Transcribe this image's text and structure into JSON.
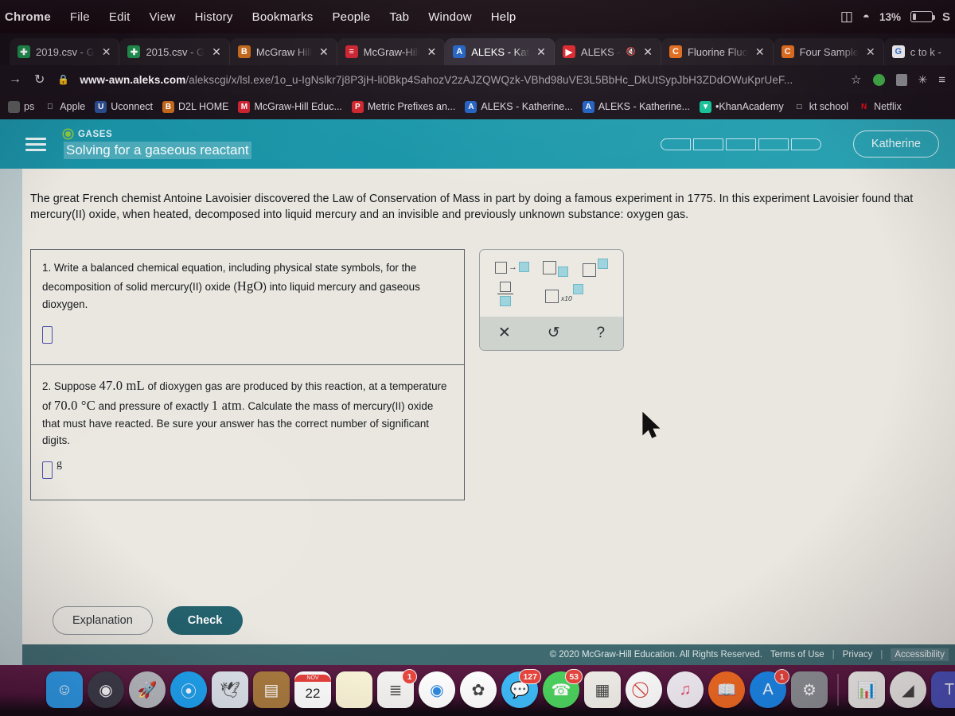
{
  "macos": {
    "menu_items": [
      "Chrome",
      "File",
      "Edit",
      "View",
      "History",
      "Bookmarks",
      "People",
      "Tab",
      "Window",
      "Help"
    ],
    "status": {
      "battery_percent": "13%",
      "trailing_letter": "S",
      "icons": [
        "airplay-icon",
        "wifi-icon",
        "battery-icon"
      ]
    }
  },
  "browser": {
    "tabs": [
      {
        "label": "2019.csv - G",
        "favicon": "sheets-icon",
        "color": "#1d8b4b",
        "glyph": "✚",
        "active": false
      },
      {
        "label": "2015.csv - G",
        "favicon": "sheets-icon",
        "color": "#1d8b4b",
        "glyph": "✚",
        "active": false
      },
      {
        "label": "McGraw Hill",
        "favicon": "bookshelf-icon",
        "color": "#c0651b",
        "glyph": "B",
        "active": false
      },
      {
        "label": "McGraw-Hill",
        "favicon": "mheducation-icon",
        "color": "#c9202e",
        "glyph": "≡",
        "active": false
      },
      {
        "label": "ALEKS - Kat",
        "favicon": "aleks-icon",
        "color": "#1f5fbf",
        "glyph": "A",
        "active": true
      },
      {
        "label": "ALEKS -",
        "favicon": "youtube-icon",
        "color": "#d8232a",
        "glyph": "▶",
        "active": false,
        "muted_icon": "audio-muted-icon"
      },
      {
        "label": "Fluorine Fluo",
        "favicon": "course-hero-icon",
        "color": "#e06a1b",
        "glyph": "C",
        "active": false
      },
      {
        "label": "Four Sample",
        "favicon": "course-hero-icon",
        "color": "#e06a1b",
        "glyph": "C",
        "active": false
      },
      {
        "label": "c to k -",
        "favicon": "google-icon",
        "color": "#ffffff",
        "glyph": "G",
        "active": false
      }
    ],
    "address": {
      "lock_icon": "padlock-icon",
      "domain": "www-awn.aleks.com",
      "path": "/alekscgi/x/lsl.exe/1o_u-IgNslkr7j8P3jH-li0Bkp4SahozV2zAJZQWQzk-VBhd98uVE3L5BbHc_DkUtSypJbH3ZDdOWuKprUeF...",
      "nav_icons": [
        "forward-arrow-icon",
        "reload-icon"
      ],
      "right_icons": [
        "bookmark-star-icon",
        "extension-green-icon",
        "extension-grey-icon",
        "extensions-puzzle-icon",
        "chrome-menu-icon"
      ]
    },
    "bookmarks": [
      {
        "label": "ps",
        "icon": "apps-icon",
        "color": "#5a5a5a",
        "glyph": ""
      },
      {
        "label": "Apple",
        "icon": "apple-icon",
        "color": "#00000000",
        "glyph": ""
      },
      {
        "label": "Uconnect",
        "icon": "uconnect-icon",
        "color": "#2a4b8d",
        "glyph": "U"
      },
      {
        "label": "D2L HOME",
        "icon": "d2l-icon",
        "color": "#c0651b",
        "glyph": "B"
      },
      {
        "label": "McGraw-Hill Educ...",
        "icon": "mcgrawhill-icon",
        "color": "#c9202e",
        "glyph": "M"
      },
      {
        "label": "Metric Prefixes an...",
        "icon": "pdf-icon",
        "color": "#cc2229",
        "glyph": "P"
      },
      {
        "label": "ALEKS - Katherine...",
        "icon": "aleks-icon",
        "color": "#1f5fbf",
        "glyph": "A"
      },
      {
        "label": "ALEKS - Katherine...",
        "icon": "aleks-icon",
        "color": "#1f5fbf",
        "glyph": "A"
      },
      {
        "label": "•KhanAcademy",
        "icon": "khanacademy-icon",
        "color": "#14bf96",
        "glyph": "▼"
      },
      {
        "label": "kt school",
        "icon": "folder-icon",
        "color": "#00000000",
        "glyph": "□"
      },
      {
        "label": "Netflix",
        "icon": "netflix-icon",
        "color": "#00000000",
        "glyph": "N"
      }
    ]
  },
  "aleks": {
    "header": {
      "menu_icon": "hamburger-menu-icon",
      "topic_dot": "topic-status-dot",
      "kicker": "GASES",
      "title": "Solving for a gaseous reactant",
      "progress_segments": 5,
      "user_name": "Katherine",
      "chevron_icon": "chevron-down-icon"
    },
    "intro": "The great French chemist Antoine Lavoisier discovered the Law of Conservation of Mass in part by doing a famous experiment in 1775. In this experiment Lavoisier found that mercury(II) oxide, when heated, decomposed into liquid mercury and an invisible and previously unknown substance: oxygen gas.",
    "questions": [
      {
        "number": "1.",
        "text_a": "Write a balanced chemical equation, including physical state symbols, for the decomposition of solid mercury(II) oxide (",
        "formula": "HgO",
        "text_b": ") into liquid mercury and gaseous dioxygen.",
        "answer_value": "",
        "unit": ""
      },
      {
        "number": "2.",
        "text_a": "Suppose ",
        "value_volume": "47.0 mL",
        "text_b": " of dioxygen gas are produced by this reaction, at a temperature of ",
        "value_temp": "70.0 °C",
        "text_c": " and pressure of exactly ",
        "value_pressure": "1 atm",
        "text_d": ". Calculate the mass of mercury(II) oxide that must have reacted. Be sure your answer has the correct number of significant digits.",
        "answer_value": "",
        "unit": "g"
      }
    ],
    "palette": {
      "tools": [
        {
          "name": "reaction-arrow-tool",
          "label": "□→□"
        },
        {
          "name": "subscript-tool",
          "label": "□▁□"
        },
        {
          "name": "superscript-tool",
          "label": "□¹□"
        },
        {
          "name": "fraction-tool",
          "label": "□/□"
        },
        {
          "name": "times-ten-exponent-tool",
          "label": "□ x10"
        }
      ],
      "actions": [
        {
          "name": "clear-button",
          "glyph": "✕"
        },
        {
          "name": "undo-button",
          "glyph": "↺"
        },
        {
          "name": "help-button",
          "glyph": "?"
        }
      ],
      "x10_label": "x10"
    },
    "buttons": {
      "explanation": "Explanation",
      "check": "Check"
    },
    "footer": {
      "copyright": "© 2020 McGraw-Hill Education. All Rights Reserved.",
      "links": [
        "Terms of Use",
        "Privacy",
        "Accessibility"
      ],
      "separator": "|"
    }
  },
  "dock": {
    "items": [
      {
        "name": "finder",
        "color": "#2b9bea",
        "glyph": "☺",
        "round": false,
        "badge": ""
      },
      {
        "name": "siri",
        "color": "#3a3a46",
        "glyph": "◉",
        "round": true,
        "badge": ""
      },
      {
        "name": "launchpad",
        "color": "#b9bcc2",
        "glyph": "🚀",
        "round": true,
        "badge": ""
      },
      {
        "name": "safari",
        "color": "#1ba3f2",
        "glyph": "⦿",
        "round": true,
        "badge": ""
      },
      {
        "name": "photos-preview",
        "color": "#dfe6ee",
        "glyph": "🕊",
        "round": false,
        "badge": ""
      },
      {
        "name": "contacts",
        "color": "#a8793c",
        "glyph": "▤",
        "round": false,
        "badge": ""
      },
      {
        "name": "calendar",
        "color": "#ffffff",
        "glyph": "22",
        "round": false,
        "badge": "",
        "month": "NOV"
      },
      {
        "name": "notes",
        "color": "#fbf5d8",
        "glyph": "",
        "round": false,
        "badge": ""
      },
      {
        "name": "reminders",
        "color": "#f6f5f3",
        "glyph": "≣",
        "round": false,
        "badge": "1"
      },
      {
        "name": "chrome",
        "color": "#ffffff",
        "glyph": "◉",
        "round": true,
        "badge": ""
      },
      {
        "name": "photos",
        "color": "#ffffff",
        "glyph": "✿",
        "round": true,
        "badge": ""
      },
      {
        "name": "messages",
        "color": "#3ebaf7",
        "glyph": "💬",
        "round": true,
        "badge": "127"
      },
      {
        "name": "facetime",
        "color": "#4cd25e",
        "glyph": "☎",
        "round": true,
        "badge": "53"
      },
      {
        "name": "keynote",
        "color": "#f2f0ea",
        "glyph": "▦",
        "round": false,
        "badge": ""
      },
      {
        "name": "adblock",
        "color": "#ffffff",
        "glyph": "⃠",
        "round": true,
        "badge": ""
      },
      {
        "name": "itunes",
        "color": "#f4eff6",
        "glyph": "♫",
        "round": true,
        "badge": ""
      },
      {
        "name": "ibooks",
        "color": "#f06a22",
        "glyph": "📖",
        "round": true,
        "badge": ""
      },
      {
        "name": "app-store",
        "color": "#1b87e8",
        "glyph": "A",
        "round": true,
        "badge": "1"
      },
      {
        "name": "system-preferences",
        "color": "#8e9196",
        "glyph": "⚙",
        "round": false,
        "badge": ""
      },
      {
        "name": "divider",
        "color": "",
        "glyph": "",
        "round": false,
        "badge": ""
      },
      {
        "name": "numbers",
        "color": "#f3f2ee",
        "glyph": "📊",
        "round": false,
        "badge": ""
      },
      {
        "name": "image-capture",
        "color": "#f4f3ef",
        "glyph": "◢",
        "round": true,
        "badge": ""
      },
      {
        "name": "microsoft-teams",
        "color": "#4b53bc",
        "glyph": "T",
        "round": false,
        "badge": ""
      },
      {
        "name": "divider2",
        "color": "",
        "glyph": "",
        "round": false,
        "badge": ""
      },
      {
        "name": "excel-document",
        "color": "#f0efeb",
        "glyph": "▦",
        "round": false,
        "badge": ""
      }
    ]
  }
}
